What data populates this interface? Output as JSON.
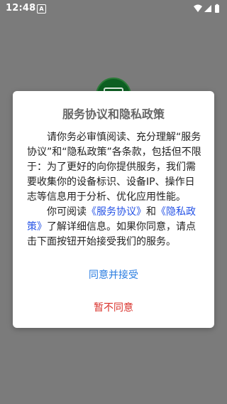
{
  "status_bar": {
    "time": "12:48",
    "notification_icon": "A",
    "icons": [
      "wifi-icon",
      "signal-icon",
      "battery-icon"
    ]
  },
  "dialog": {
    "title": "服务协议和隐私政策",
    "para1": "请你务必审慎阅读、充分理解“服务协议”和“隐私政策”各条款，包括但不限于：为了更好的向你提供服务，我们需要收集你的设备标识、设备IP、操作日志等信息用于分析、优化应用性能。",
    "para2_prefix": "你可阅读",
    "link_terms": "《服务协议》",
    "para2_and": "和",
    "link_privacy": "《隐私政策》",
    "para2_suffix": "了解详细信息。如果你同意，请点击下面按钮开始接受我们的服务。",
    "agree_label": "同意并接受",
    "disagree_label": "暂不同意"
  },
  "colors": {
    "link": "#2452e6",
    "agree": "#2a7de1",
    "disagree": "#d9302a",
    "title": "#666666"
  }
}
